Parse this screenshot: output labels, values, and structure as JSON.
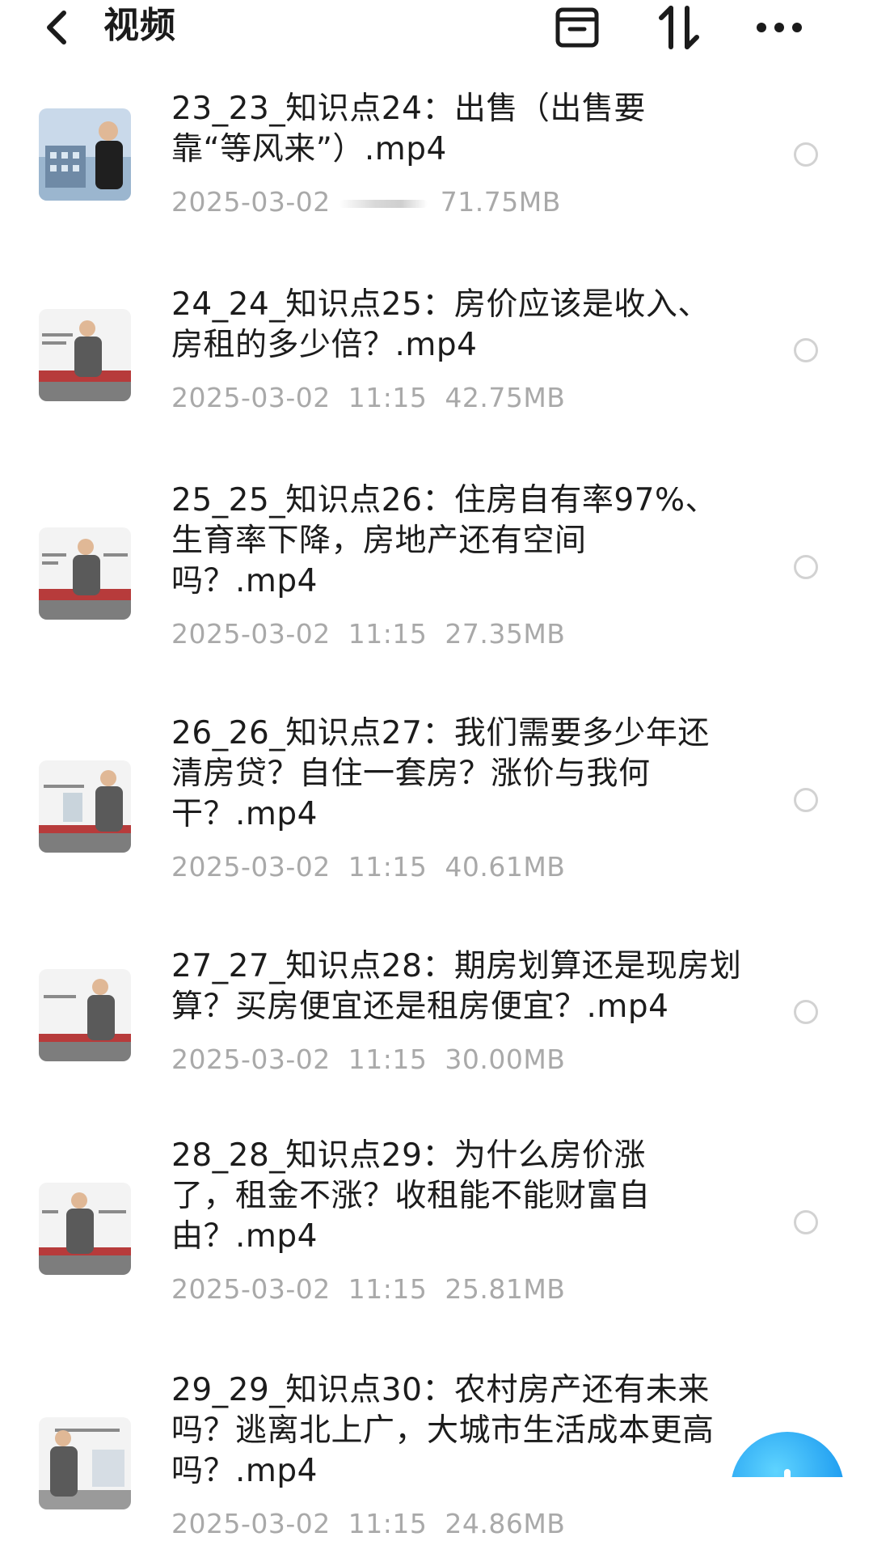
{
  "header": {
    "title": "视频",
    "back_icon": "chevron-left-icon",
    "archive_icon": "archive-box-icon",
    "sort_icon": "sort-arrows-icon",
    "more_icon": "more-dots-icon"
  },
  "items": [
    {
      "title": "23_23_知识点24：出售（出售要靠“等风来”）.mp4",
      "date": "2025-03-02",
      "time": "",
      "size": "71.75MB",
      "thumb_icon": "video-thumbnail-icon"
    },
    {
      "title": "24_24_知识点25：房价应该是收入、房租的多少倍？.mp4",
      "date": "2025-03-02",
      "time": "11:15",
      "size": "42.75MB",
      "thumb_icon": "video-thumbnail-icon"
    },
    {
      "title": "25_25_知识点26：住房自有率97%、生育率下降，房地产还有空间吗？.mp4",
      "date": "2025-03-02",
      "time": "11:15",
      "size": "27.35MB",
      "thumb_icon": "video-thumbnail-icon"
    },
    {
      "title": "26_26_知识点27：我们需要多少年还清房贷？自住一套房？涨价与我何干？.mp4",
      "date": "2025-03-02",
      "time": "11:15",
      "size": "40.61MB",
      "thumb_icon": "video-thumbnail-icon"
    },
    {
      "title": "27_27_知识点28：期房划算还是现房划算？买房便宜还是租房便宜？.mp4",
      "date": "2025-03-02",
      "time": "11:15",
      "size": "30.00MB",
      "thumb_icon": "video-thumbnail-icon"
    },
    {
      "title": "28_28_知识点29：为什么房价涨了，租金不涨？收租能不能财富自由？.mp4",
      "date": "2025-03-02",
      "time": "11:15",
      "size": "25.81MB",
      "thumb_icon": "video-thumbnail-icon"
    },
    {
      "title": "29_29_知识点30：农村房产还有未来吗？逃离北上广，大城市生活成本更高吗？.mp4",
      "date": "2025-03-02",
      "time": "11:15",
      "size": "24.86MB",
      "thumb_icon": "video-thumbnail-icon"
    }
  ],
  "fab": {
    "icon": "add-icon",
    "color": "#1e9cf0"
  }
}
